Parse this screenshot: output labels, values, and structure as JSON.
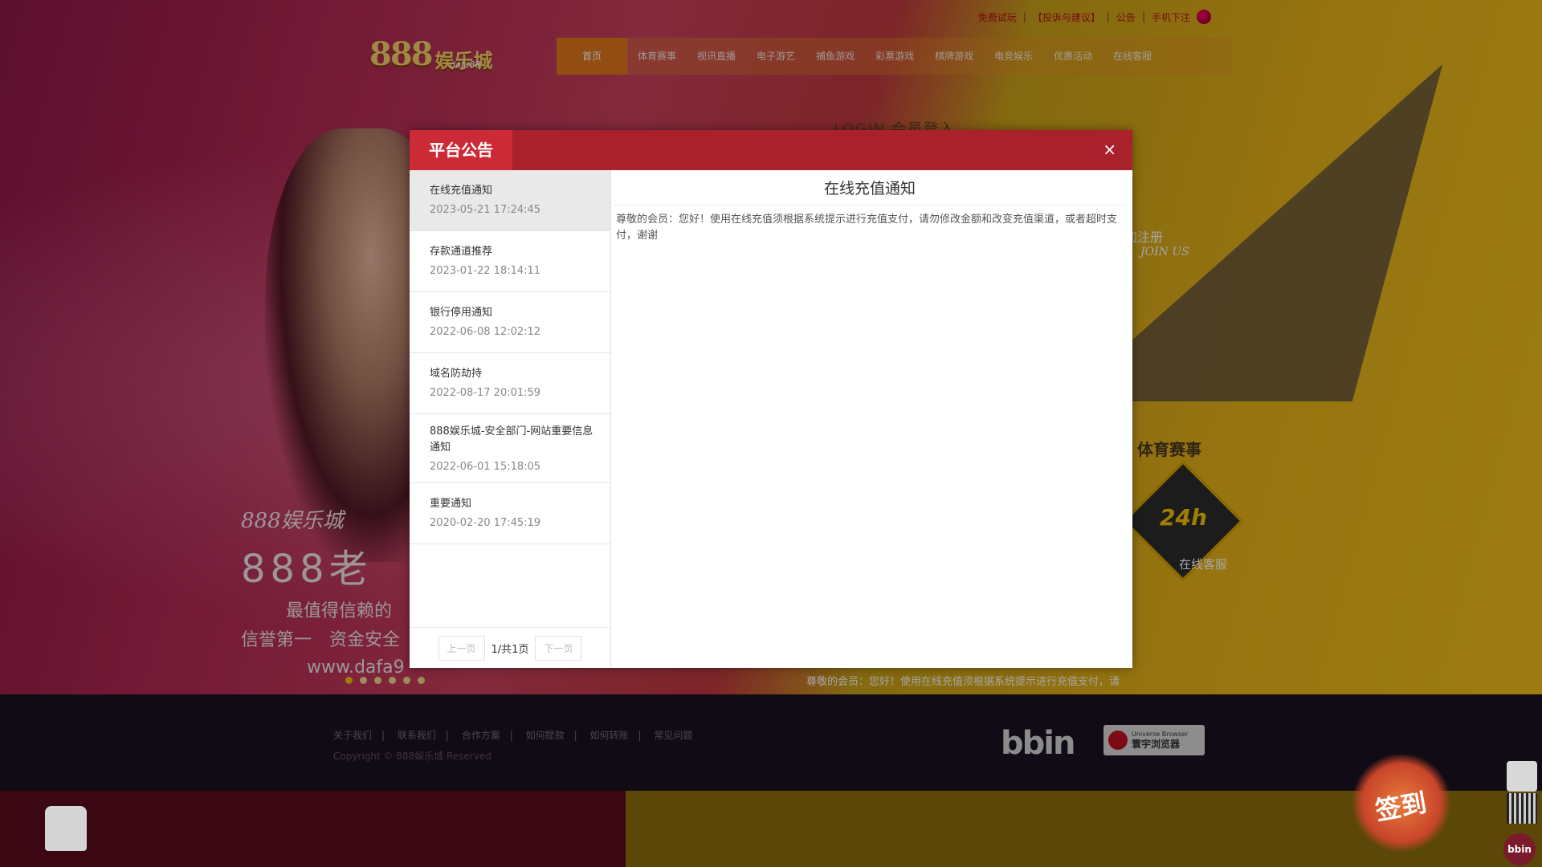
{
  "topbar": {
    "links": [
      "免费试玩",
      "【投诉与建议】",
      "公告",
      "手机下注"
    ]
  },
  "logo": {
    "number": "888",
    "name": "娱乐城",
    "sub": "dafa88"
  },
  "nav": [
    "首页",
    "体育赛事",
    "视讯直播",
    "电子游艺",
    "捕鱼游戏",
    "彩票游戏",
    "棋牌游戏",
    "电竞娱乐",
    "优惠活动",
    "在线客服"
  ],
  "banner": {
    "login_title": "LOGIN 会员登入",
    "line1": "888娱乐城",
    "line2": "888老",
    "line3": "最值得信赖的",
    "line4": "信誉第一　资金安全",
    "line5": "www.dafa9",
    "join_label": "加注册",
    "join_en": "JOIN US",
    "sports_label": "体育赛事",
    "cs_24": "24h",
    "cs_label": "在线客服",
    "notice_preview": "尊敬的会员：您好！使用在线充值须根据系统提示进行充值支付，请"
  },
  "footer": {
    "links": [
      "关于我们",
      "联系我们",
      "合作方案",
      "如何提款",
      "如何转账",
      "常见问题"
    ],
    "copyright": "Copyright © 888娱乐城 Reserved",
    "bbin": "bbin",
    "ub_en": "Universe Browser",
    "ub_cn": "寰宇浏览器"
  },
  "floating": {
    "sign_in": "签到",
    "bbin": "bbin"
  },
  "modal": {
    "title": "平台公告",
    "close_symbol": "×",
    "selected_title": "在线充值通知",
    "selected_body": "尊敬的会员：您好！使用在线充值须根据系统提示进行充值支付，请勿修改金额和改变充值渠道，或者超时支付，谢谢",
    "items": [
      {
        "title": "在线充值通知",
        "date": "2023-05-21 17:24:45"
      },
      {
        "title": "存款通道推荐",
        "date": "2023-01-22 18:14:11"
      },
      {
        "title": "银行停用通知",
        "date": "2022-06-08 12:02:12"
      },
      {
        "title": "域名防劫持",
        "date": "2022-08-17 20:01:59"
      },
      {
        "title": "888娱乐城-安全部门-网站重要信息通知",
        "date": "2022-06-01 15:18:05"
      },
      {
        "title": "重要通知",
        "date": "2020-02-20 17:45:19"
      }
    ],
    "pager": {
      "prev": "上一页",
      "info": "1/共1页",
      "next": "下一页"
    }
  },
  "colors": {
    "modal_header": "#a8212b",
    "modal_title_tab": "#cc2a36",
    "nav_active": "#e0781c"
  }
}
